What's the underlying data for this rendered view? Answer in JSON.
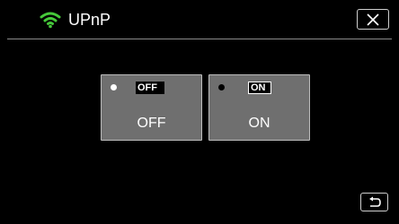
{
  "header": {
    "title": "UPnP",
    "wifi_icon": "wifi-icon",
    "close_icon": "close-icon"
  },
  "options": [
    {
      "key": "off",
      "icon_text": "OFF",
      "label": "OFF",
      "selected": false
    },
    {
      "key": "on",
      "icon_text": "ON",
      "label": "ON",
      "selected": true
    }
  ],
  "footer": {
    "back_icon": "back-icon"
  },
  "colors": {
    "background": "#000000",
    "button_fill": "#6f6f6f",
    "button_border": "#bdbdbd",
    "wifi_green": "#46c93a",
    "text": "#ffffff"
  }
}
